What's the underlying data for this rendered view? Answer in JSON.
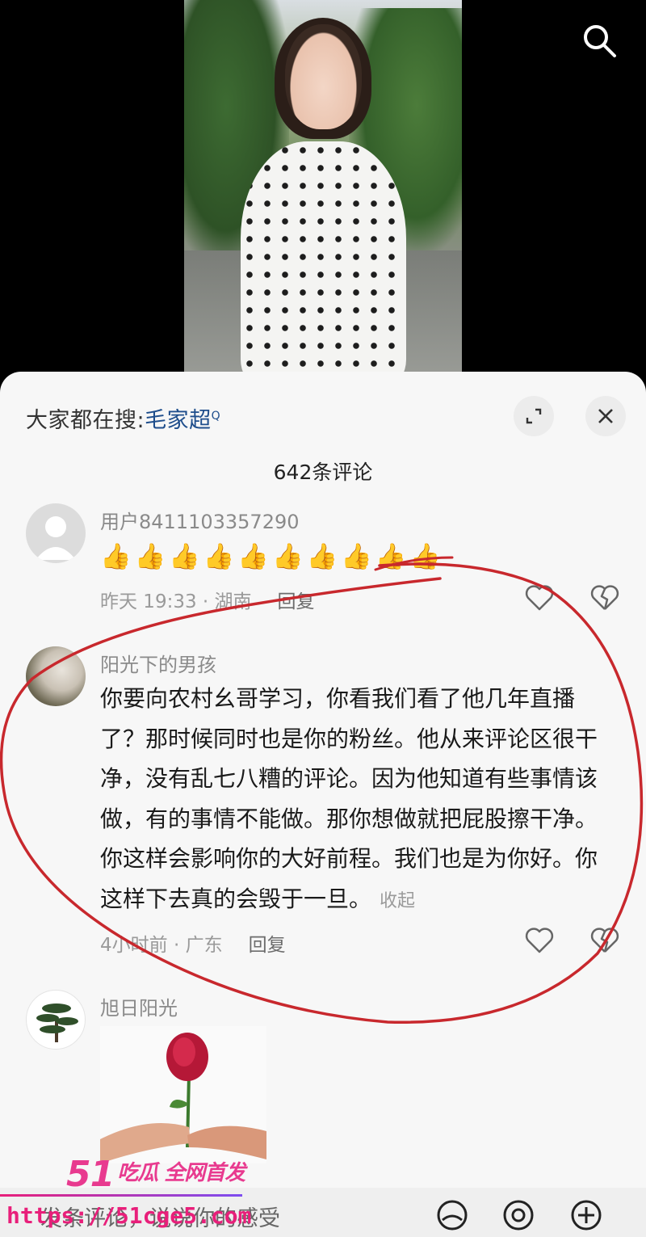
{
  "video": {
    "search_icon": "search-icon"
  },
  "panel": {
    "hot_search_prefix": "大家都在搜:",
    "hot_search_keyword": "毛家超",
    "hot_search_sup": "Q",
    "expand_icon": "expand-icon",
    "close_icon": "close-icon",
    "comment_count": "642条评论"
  },
  "comments": [
    {
      "username": "用户8411103357290",
      "text": "👍👍👍👍👍👍👍👍👍👍",
      "time_location": "昨天 19:33 · 湖南",
      "reply_label": "回复"
    },
    {
      "username": "阳光下的男孩",
      "text": "你要向农村幺哥学习，你看我们看了他几年直播了？那时候同时也是你的粉丝。他从来评论区很干净，没有乱七八糟的评论。因为他知道有些事情该做，有的事情不能做。那你想做就把屁股擦干净。你这样会影响你的大好前程。我们也是为你好。你这样下去真的会毁于一旦。",
      "fold_label": "收起",
      "time_location": "4小时前 · 广东",
      "reply_label": "回复"
    },
    {
      "username": "旭日阳光"
    }
  ],
  "input": {
    "placeholder": "发条评论，说说你的感受"
  },
  "watermark": {
    "brand": "51",
    "brand_cn": "吃瓜 全网首发",
    "url": "https://51cge5.com"
  },
  "colors": {
    "annotation_red": "#c8282d",
    "keyword_blue": "#1f4e8c",
    "watermark_pink": "#e81f7a"
  }
}
